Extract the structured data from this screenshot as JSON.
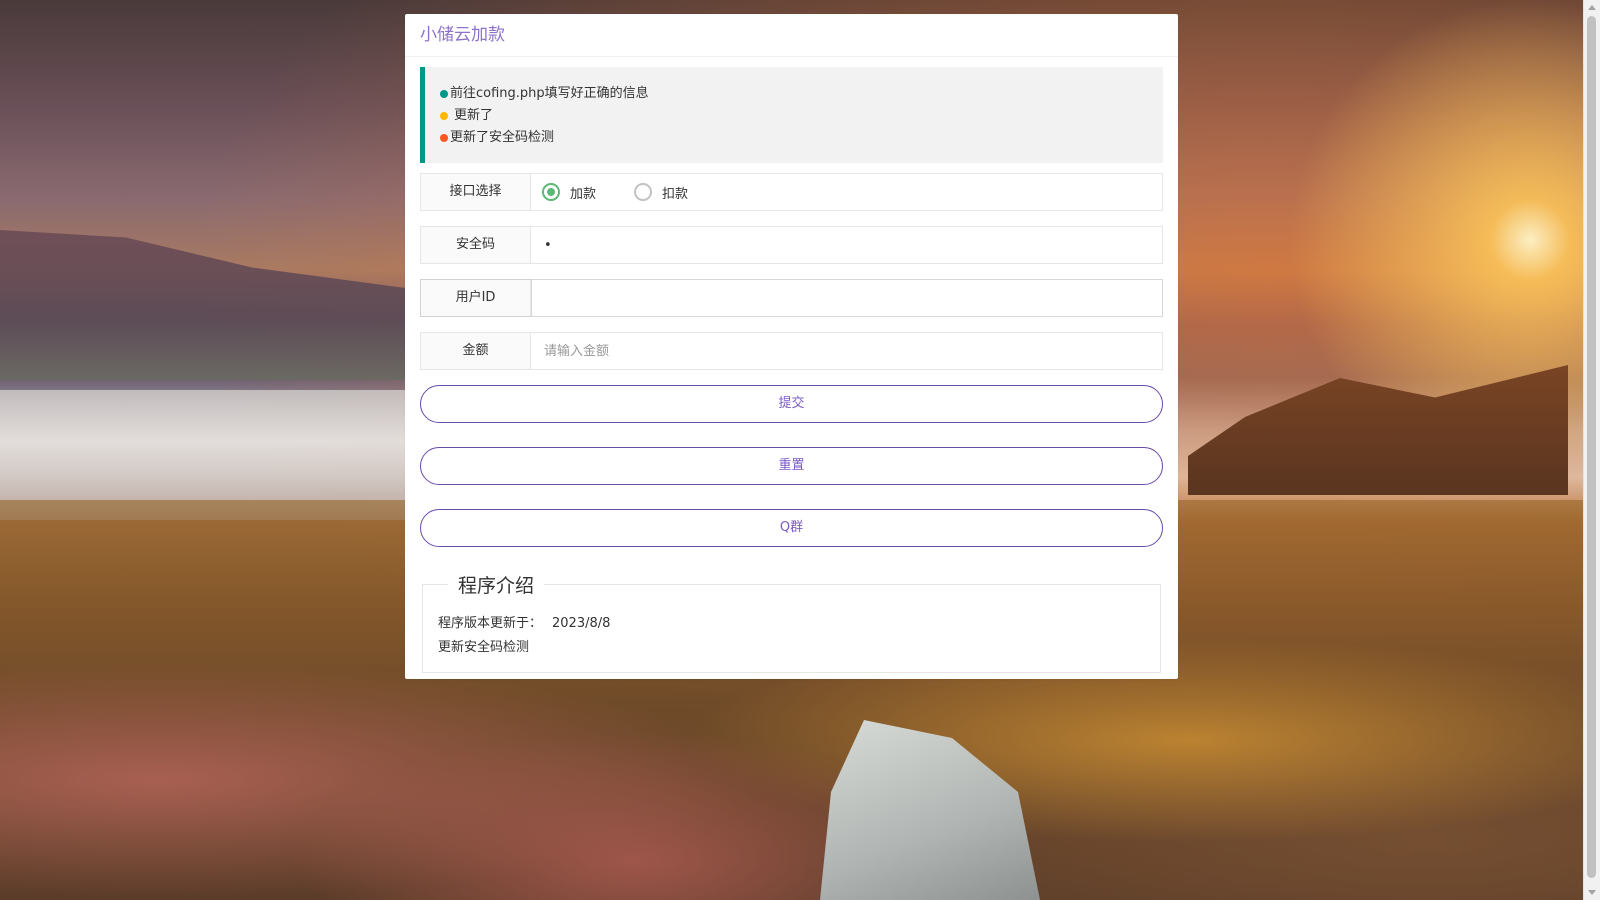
{
  "panel": {
    "title": "小储云加款"
  },
  "notice": {
    "items": [
      {
        "text": "前往cofing.php填写好正确的信息",
        "color": "#009688"
      },
      {
        "text": "更新了",
        "color": "#ffb800"
      },
      {
        "text": "更新了安全码检测",
        "color": "#ff5722"
      }
    ]
  },
  "form": {
    "api": {
      "label": "接口选择",
      "options": [
        {
          "label": "加款",
          "checked": true
        },
        {
          "label": "扣款",
          "checked": false
        }
      ]
    },
    "code": {
      "label": "安全码",
      "value": "•"
    },
    "userid": {
      "label": "用户ID",
      "value": ""
    },
    "amount": {
      "label": "金额",
      "placeholder": "请输入金额"
    }
  },
  "buttons": {
    "submit": "提交",
    "reset": "重置",
    "qgroup": "Q群"
  },
  "intro": {
    "legend": "程序介绍",
    "version_label": "程序版本更新于：",
    "version_value": "2023/8/8",
    "changelog": "更新安全码检测"
  },
  "colors": {
    "accent": "#7a5bc2",
    "title": "#8d72c9",
    "notice_border": "#009688",
    "radio_checked": "#5fb878"
  }
}
